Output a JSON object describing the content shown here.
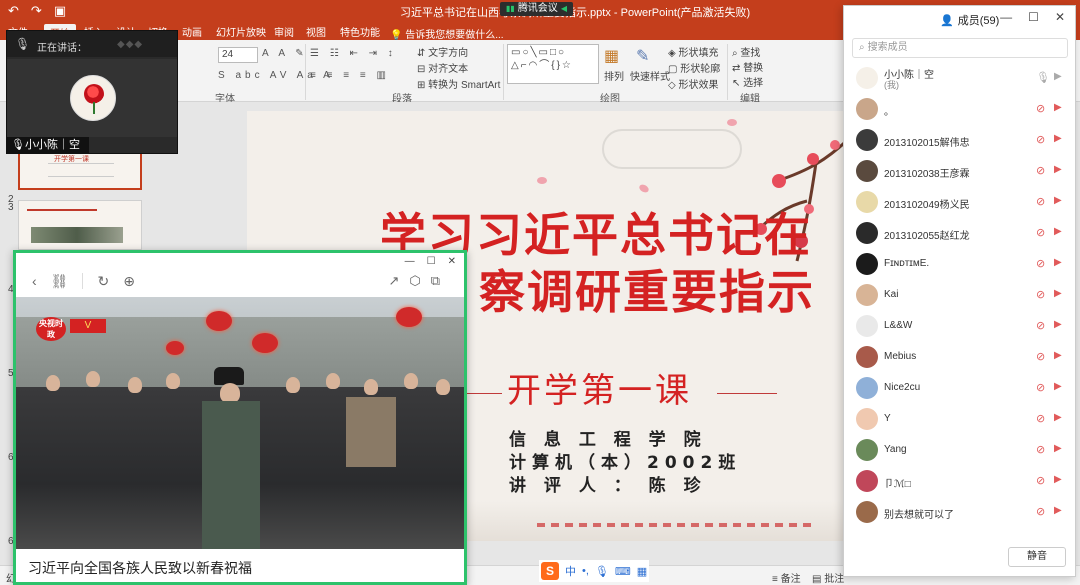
{
  "ppt": {
    "title": "习近平总书记在山西考察调研重要指示.pptx - PowerPoint(产品激活失败)",
    "meeting_label": "腾讯会议",
    "qat_icons": [
      "undo-icon",
      "redo-icon",
      "start-slideshow-icon"
    ],
    "tabs": [
      "文件",
      "开始",
      "插入",
      "设计",
      "切换",
      "动画",
      "幻灯片放映",
      "审阅",
      "视图",
      "特色功能"
    ],
    "search_hint": "告诉我您想要做什么...",
    "ribbon": {
      "font_size": "24",
      "group_font": "字体",
      "group_paragraph": "段落",
      "group_drawing": "绘图",
      "group_editing": "编辑",
      "text_direction": "文字方向",
      "align_text": "对齐文本",
      "smartart": "转换为 SmartArt",
      "arrange": "排列",
      "quick_styles": "快速样式",
      "shape_fill": "形状填充",
      "shape_outline": "形状轮廓",
      "shape_effects": "形状效果",
      "find": "查找",
      "replace": "替换",
      "select": "选择"
    },
    "thumbnails": [
      {
        "num": "2",
        "title": "开学第一课"
      },
      {
        "num": "3",
        "title": ""
      },
      {
        "num": "4",
        "title": ""
      },
      {
        "num": "5",
        "title": ""
      },
      {
        "num": "6",
        "title": ""
      }
    ],
    "status": {
      "left": "幻灯",
      "notes": "备注",
      "comments": "批注"
    }
  },
  "slide": {
    "title_line1": "学习习近平总书记在",
    "title_line2": "察调研重要指示",
    "subtitle": "开学第一课",
    "info_line1": "信 息 工 程 学 院",
    "info_line2": "计算机（本）2002班",
    "info_line3": "讲 评 人 ： 陈 珍"
  },
  "speaker": {
    "label": "正在讲话：",
    "name": "小小陈｜空"
  },
  "browser": {
    "caption": "习近平向全国各族人民致以新春祝福",
    "logo_text": "央视时政",
    "logo_badge": "V"
  },
  "members": {
    "title": "成员(59)",
    "search_placeholder": "搜索成员",
    "mute_all": "静音",
    "list": [
      {
        "name": "小小陈｜空",
        "sub": "(我)",
        "mic": "ok",
        "cam": "ok",
        "avatar": "#f5f0e8"
      },
      {
        "name": "。",
        "sub": "",
        "mic": "off",
        "cam": "off",
        "avatar": "#c9a68a"
      },
      {
        "name": "2013102015解伟忠",
        "sub": "",
        "mic": "off",
        "cam": "off",
        "avatar": "#3b3b3b"
      },
      {
        "name": "2013102038王彦霖",
        "sub": "",
        "mic": "off",
        "cam": "off",
        "avatar": "#5a4a3e"
      },
      {
        "name": "2013102049杨义民",
        "sub": "",
        "mic": "off",
        "cam": "off",
        "avatar": "#e8d9a8"
      },
      {
        "name": "2013102055赵红龙",
        "sub": "",
        "mic": "off",
        "cam": "off",
        "avatar": "#2a2a2a"
      },
      {
        "name": "FɪɴᴅᴛɪᴍE.",
        "sub": "",
        "mic": "off",
        "cam": "off",
        "avatar": "#1b1b1b"
      },
      {
        "name": "Kai",
        "sub": "",
        "mic": "off",
        "cam": "off",
        "avatar": "#d8b496"
      },
      {
        "name": "L&&W",
        "sub": "",
        "mic": "off",
        "cam": "off",
        "avatar": "#e9e9e9"
      },
      {
        "name": "Mebius",
        "sub": "",
        "mic": "off",
        "cam": "off",
        "avatar": "#a85a4a"
      },
      {
        "name": "Nice2cu",
        "sub": "",
        "mic": "off",
        "cam": "off",
        "avatar": "#8fb0d8"
      },
      {
        "name": "Y",
        "sub": "",
        "mic": "off",
        "cam": "off",
        "avatar": "#f0c9b0"
      },
      {
        "name": "Yang",
        "sub": "",
        "mic": "off",
        "cam": "off",
        "avatar": "#6a8a5a"
      },
      {
        "name": "卩ℳ□",
        "sub": "",
        "mic": "off",
        "cam": "off",
        "avatar": "#c0475a"
      },
      {
        "name": "别去想就可以了",
        "sub": "",
        "mic": "off",
        "cam": "off",
        "avatar": "#9a6a4a"
      }
    ]
  },
  "ime": {
    "lang": "中",
    "icons": [
      "punctuation-icon",
      "mic-icon",
      "keyboard-icon",
      "apps-icon"
    ]
  }
}
